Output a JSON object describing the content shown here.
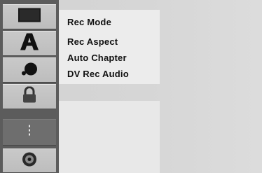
{
  "sidebar": {
    "items": [
      {
        "icon": "tv-screen-icon",
        "selected": false
      },
      {
        "icon": "letter-a-icon",
        "selected": false
      },
      {
        "icon": "color-drop-icon",
        "selected": false
      },
      {
        "icon": "padlock-icon",
        "selected": false
      },
      {
        "icon": "record-dots-icon",
        "selected": true
      },
      {
        "icon": "disc-icon",
        "selected": false
      }
    ]
  },
  "submenu": {
    "items": [
      {
        "label": "Rec Mode"
      },
      {
        "label": "Rec Aspect"
      },
      {
        "label": "Auto Chapter"
      },
      {
        "label": "DV Rec Audio"
      }
    ]
  },
  "colors": {
    "sidebar_bg": "#5c5c5c",
    "item_bg": "#c4c4c4",
    "selected_bg": "#6e6e6e",
    "panel_bg": "#ececec"
  }
}
